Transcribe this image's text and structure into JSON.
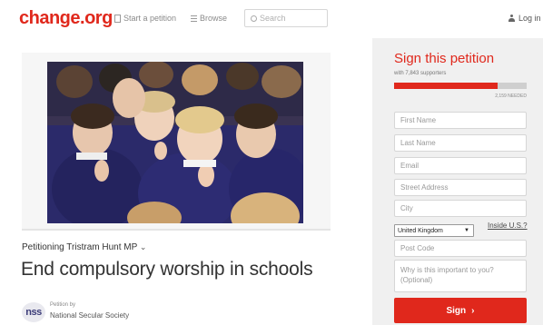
{
  "header": {
    "logo": "change.org",
    "start_petition": "Start a petition",
    "browse": "Browse",
    "search_placeholder": "Search",
    "login": "Log in"
  },
  "petition": {
    "petitioning": "Petitioning Tristram Hunt MP",
    "title": "End compulsory worship in schools",
    "petition_by_label": "Petition by",
    "author_logo_text": "nss",
    "author": "National Secular Society"
  },
  "sign_panel": {
    "heading": "Sign this petition",
    "supporters": "with 7,843 supporters",
    "progress_fraction": 0.78,
    "goal": "2,159 NEEDED",
    "fields": {
      "first_name": "First Name",
      "last_name": "Last Name",
      "email": "Email",
      "street": "Street Address",
      "city": "City",
      "country": "United Kingdom",
      "inside_us": "Inside U.S.?",
      "postcode": "Post Code",
      "reason": "Why is this important to you? (Optional)"
    },
    "sign_button": "Sign",
    "sign_arrow": "›"
  },
  "colors": {
    "brand": "#e0281c",
    "sidebar_bg": "#f0f0f0",
    "progress_track": "#cfcfcf"
  }
}
